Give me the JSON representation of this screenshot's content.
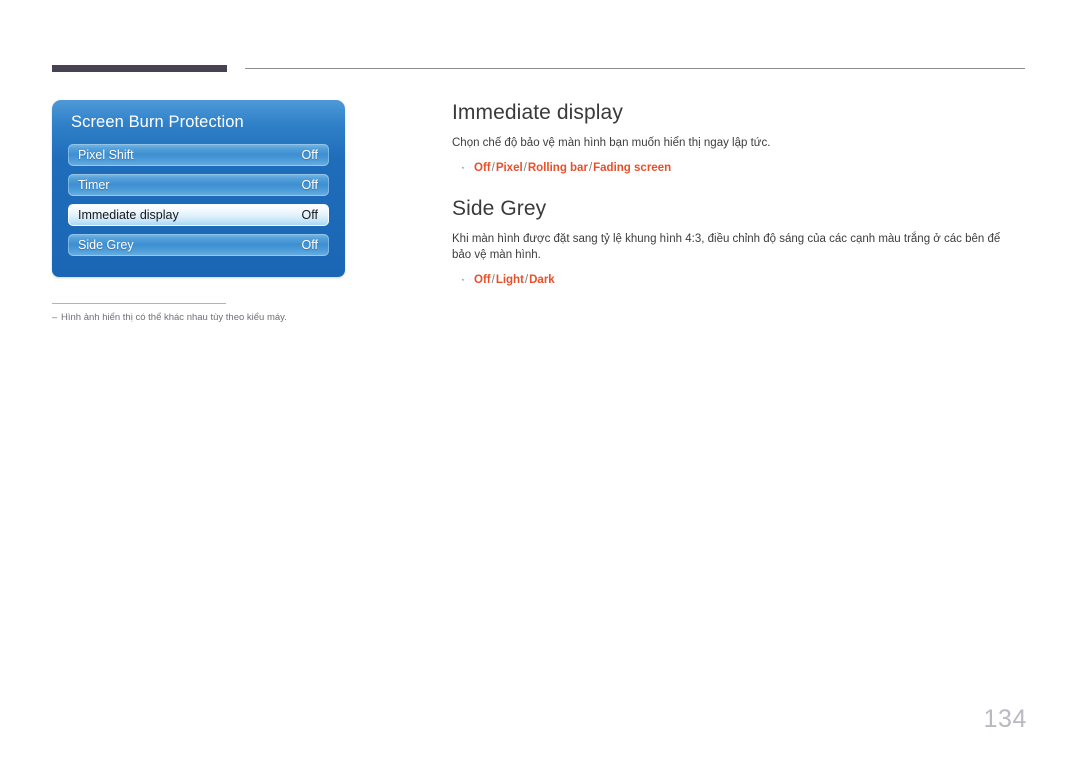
{
  "header": {
    "dark_bar": "",
    "thin_rule": ""
  },
  "osd_panel": {
    "title": "Screen Burn Protection",
    "rows": [
      {
        "label": "Pixel Shift",
        "value": "Off",
        "selected": false
      },
      {
        "label": "Timer",
        "value": "Off",
        "selected": false
      },
      {
        "label": "Immediate display",
        "value": "Off",
        "selected": true
      },
      {
        "label": "Side Grey",
        "value": "Off",
        "selected": false
      }
    ]
  },
  "footnote": {
    "dash": "–",
    "text": "Hình ảnh hiển thị có thể khác nhau tùy theo kiểu máy."
  },
  "sections": [
    {
      "heading": "Immediate display",
      "body": "Chọn chế độ bảo vệ màn hình bạn muốn hiển thị ngay lập tức.",
      "bullet": "·",
      "options": [
        "Off",
        "Pixel",
        "Rolling bar",
        "Fading screen"
      ],
      "separator": "/"
    },
    {
      "heading": "Side Grey",
      "body": "Khi màn hình được đặt sang tỷ lệ khung hình 4:3, điều chỉnh độ sáng của các cạnh màu trắng ở các bên để bảo vệ màn hình.",
      "bullet": "·",
      "options": [
        "Off",
        "Light",
        "Dark"
      ],
      "separator": "/"
    }
  ],
  "page_number": "134",
  "colors": {
    "accent_orange": "#e8502a",
    "panel_blue": "#1c69b8",
    "heading_gray": "#3a3a3c",
    "header_bar_dark": "#474152",
    "page_number_gray": "#b9b9c2"
  }
}
